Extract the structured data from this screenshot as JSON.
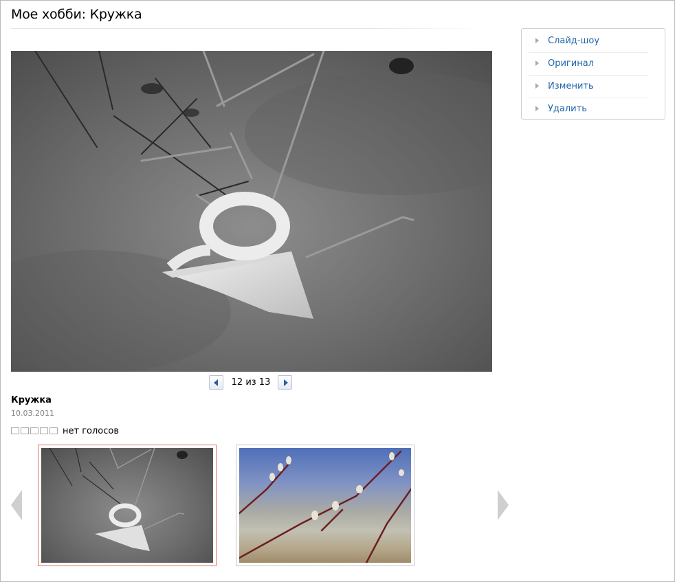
{
  "page": {
    "title": "Мое хобби: Кружка"
  },
  "sidebar": {
    "items": [
      {
        "label": "Слайд-шоу",
        "icon": "arrow-right-icon"
      },
      {
        "label": "Оригинал",
        "icon": "arrow-right-icon"
      },
      {
        "label": "Изменить",
        "icon": "arrow-right-icon"
      },
      {
        "label": "Удалить",
        "icon": "arrow-right-icon"
      }
    ],
    "link_color": "#1f64a8"
  },
  "photo": {
    "name": "Кружка",
    "date": "10.03.2011"
  },
  "pager": {
    "text": "12 из 13",
    "current": 12,
    "total": 13
  },
  "rating": {
    "stars_max": 5,
    "stars_filled": 0,
    "text": "нет голосов"
  },
  "thumbnails": {
    "active_border_color": "#e0744f",
    "items": [
      {
        "selected": true
      },
      {
        "selected": false
      }
    ]
  }
}
